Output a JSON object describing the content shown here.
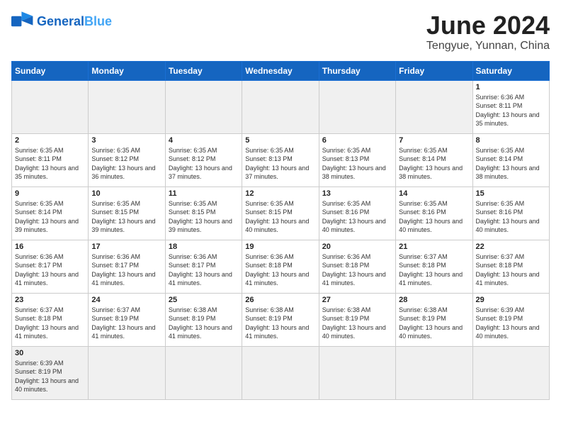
{
  "header": {
    "logo_general": "General",
    "logo_blue": "Blue",
    "month": "June 2024",
    "location": "Tengyue, Yunnan, China"
  },
  "days_of_week": [
    "Sunday",
    "Monday",
    "Tuesday",
    "Wednesday",
    "Thursday",
    "Friday",
    "Saturday"
  ],
  "weeks": [
    [
      {
        "day": "",
        "empty": true
      },
      {
        "day": "",
        "empty": true
      },
      {
        "day": "",
        "empty": true
      },
      {
        "day": "",
        "empty": true
      },
      {
        "day": "",
        "empty": true
      },
      {
        "day": "",
        "empty": true
      },
      {
        "day": "1",
        "sunrise": "Sunrise: 6:36 AM",
        "sunset": "Sunset: 8:11 PM",
        "daylight": "Daylight: 13 hours and 35 minutes."
      }
    ],
    [
      {
        "day": "2",
        "sunrise": "Sunrise: 6:35 AM",
        "sunset": "Sunset: 8:11 PM",
        "daylight": "Daylight: 13 hours and 35 minutes."
      },
      {
        "day": "3",
        "sunrise": "Sunrise: 6:35 AM",
        "sunset": "Sunset: 8:12 PM",
        "daylight": "Daylight: 13 hours and 36 minutes."
      },
      {
        "day": "4",
        "sunrise": "Sunrise: 6:35 AM",
        "sunset": "Sunset: 8:12 PM",
        "daylight": "Daylight: 13 hours and 37 minutes."
      },
      {
        "day": "5",
        "sunrise": "Sunrise: 6:35 AM",
        "sunset": "Sunset: 8:13 PM",
        "daylight": "Daylight: 13 hours and 37 minutes."
      },
      {
        "day": "6",
        "sunrise": "Sunrise: 6:35 AM",
        "sunset": "Sunset: 8:13 PM",
        "daylight": "Daylight: 13 hours and 38 minutes."
      },
      {
        "day": "7",
        "sunrise": "Sunrise: 6:35 AM",
        "sunset": "Sunset: 8:14 PM",
        "daylight": "Daylight: 13 hours and 38 minutes."
      },
      {
        "day": "8",
        "sunrise": "Sunrise: 6:35 AM",
        "sunset": "Sunset: 8:14 PM",
        "daylight": "Daylight: 13 hours and 38 minutes."
      }
    ],
    [
      {
        "day": "9",
        "sunrise": "Sunrise: 6:35 AM",
        "sunset": "Sunset: 8:14 PM",
        "daylight": "Daylight: 13 hours and 39 minutes."
      },
      {
        "day": "10",
        "sunrise": "Sunrise: 6:35 AM",
        "sunset": "Sunset: 8:15 PM",
        "daylight": "Daylight: 13 hours and 39 minutes."
      },
      {
        "day": "11",
        "sunrise": "Sunrise: 6:35 AM",
        "sunset": "Sunset: 8:15 PM",
        "daylight": "Daylight: 13 hours and 39 minutes."
      },
      {
        "day": "12",
        "sunrise": "Sunrise: 6:35 AM",
        "sunset": "Sunset: 8:15 PM",
        "daylight": "Daylight: 13 hours and 40 minutes."
      },
      {
        "day": "13",
        "sunrise": "Sunrise: 6:35 AM",
        "sunset": "Sunset: 8:16 PM",
        "daylight": "Daylight: 13 hours and 40 minutes."
      },
      {
        "day": "14",
        "sunrise": "Sunrise: 6:35 AM",
        "sunset": "Sunset: 8:16 PM",
        "daylight": "Daylight: 13 hours and 40 minutes."
      },
      {
        "day": "15",
        "sunrise": "Sunrise: 6:35 AM",
        "sunset": "Sunset: 8:16 PM",
        "daylight": "Daylight: 13 hours and 40 minutes."
      }
    ],
    [
      {
        "day": "16",
        "sunrise": "Sunrise: 6:36 AM",
        "sunset": "Sunset: 8:17 PM",
        "daylight": "Daylight: 13 hours and 41 minutes."
      },
      {
        "day": "17",
        "sunrise": "Sunrise: 6:36 AM",
        "sunset": "Sunset: 8:17 PM",
        "daylight": "Daylight: 13 hours and 41 minutes."
      },
      {
        "day": "18",
        "sunrise": "Sunrise: 6:36 AM",
        "sunset": "Sunset: 8:17 PM",
        "daylight": "Daylight: 13 hours and 41 minutes."
      },
      {
        "day": "19",
        "sunrise": "Sunrise: 6:36 AM",
        "sunset": "Sunset: 8:18 PM",
        "daylight": "Daylight: 13 hours and 41 minutes."
      },
      {
        "day": "20",
        "sunrise": "Sunrise: 6:36 AM",
        "sunset": "Sunset: 8:18 PM",
        "daylight": "Daylight: 13 hours and 41 minutes."
      },
      {
        "day": "21",
        "sunrise": "Sunrise: 6:37 AM",
        "sunset": "Sunset: 8:18 PM",
        "daylight": "Daylight: 13 hours and 41 minutes."
      },
      {
        "day": "22",
        "sunrise": "Sunrise: 6:37 AM",
        "sunset": "Sunset: 8:18 PM",
        "daylight": "Daylight: 13 hours and 41 minutes."
      }
    ],
    [
      {
        "day": "23",
        "sunrise": "Sunrise: 6:37 AM",
        "sunset": "Sunset: 8:18 PM",
        "daylight": "Daylight: 13 hours and 41 minutes."
      },
      {
        "day": "24",
        "sunrise": "Sunrise: 6:37 AM",
        "sunset": "Sunset: 8:19 PM",
        "daylight": "Daylight: 13 hours and 41 minutes."
      },
      {
        "day": "25",
        "sunrise": "Sunrise: 6:38 AM",
        "sunset": "Sunset: 8:19 PM",
        "daylight": "Daylight: 13 hours and 41 minutes."
      },
      {
        "day": "26",
        "sunrise": "Sunrise: 6:38 AM",
        "sunset": "Sunset: 8:19 PM",
        "daylight": "Daylight: 13 hours and 41 minutes."
      },
      {
        "day": "27",
        "sunrise": "Sunrise: 6:38 AM",
        "sunset": "Sunset: 8:19 PM",
        "daylight": "Daylight: 13 hours and 40 minutes."
      },
      {
        "day": "28",
        "sunrise": "Sunrise: 6:38 AM",
        "sunset": "Sunset: 8:19 PM",
        "daylight": "Daylight: 13 hours and 40 minutes."
      },
      {
        "day": "29",
        "sunrise": "Sunrise: 6:39 AM",
        "sunset": "Sunset: 8:19 PM",
        "daylight": "Daylight: 13 hours and 40 minutes."
      }
    ],
    [
      {
        "day": "30",
        "sunrise": "Sunrise: 6:39 AM",
        "sunset": "Sunset: 8:19 PM",
        "daylight": "Daylight: 13 hours and 40 minutes.",
        "last": true
      },
      {
        "day": "",
        "empty": true,
        "last": true
      },
      {
        "day": "",
        "empty": true,
        "last": true
      },
      {
        "day": "",
        "empty": true,
        "last": true
      },
      {
        "day": "",
        "empty": true,
        "last": true
      },
      {
        "day": "",
        "empty": true,
        "last": true
      },
      {
        "day": "",
        "empty": true,
        "last": true
      }
    ]
  ]
}
